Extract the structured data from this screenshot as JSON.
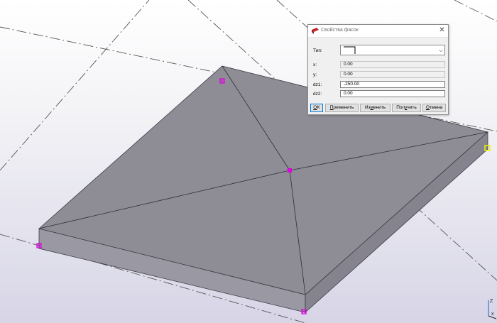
{
  "dialog": {
    "title": "Свойства фасок",
    "close_label": "✕",
    "type_label": "Тип:",
    "fields": [
      {
        "label": "x:",
        "value": "0.00",
        "editable": false
      },
      {
        "label": "y:",
        "value": "0.00",
        "editable": false
      },
      {
        "label": "dz1:",
        "value": "-250.00",
        "editable": true
      },
      {
        "label": "dz2:",
        "value": "0.00",
        "editable": true
      }
    ],
    "buttons": {
      "ok": {
        "mnemonic": "O",
        "rest": "K"
      },
      "apply": {
        "mnemonic": "П",
        "rest": "рименить"
      },
      "modify": {
        "before": "Из",
        "mnemonic": "м",
        "rest": "енить"
      },
      "get": {
        "before": "Пол",
        "mnemonic": "у",
        "rest": "чить"
      },
      "cancel": {
        "mnemonic": "О",
        "rest": "тмена"
      }
    }
  },
  "viewport": {
    "axis_labels": {
      "z": "Z",
      "x": "x"
    },
    "colors": {
      "slab_top": "#8e8d96",
      "slab_side": "#93929b",
      "edge": "#3a3a45",
      "handle_magenta": "#e000e0",
      "handle_yellow": "#f2f200",
      "grid_line": "#555555"
    }
  }
}
